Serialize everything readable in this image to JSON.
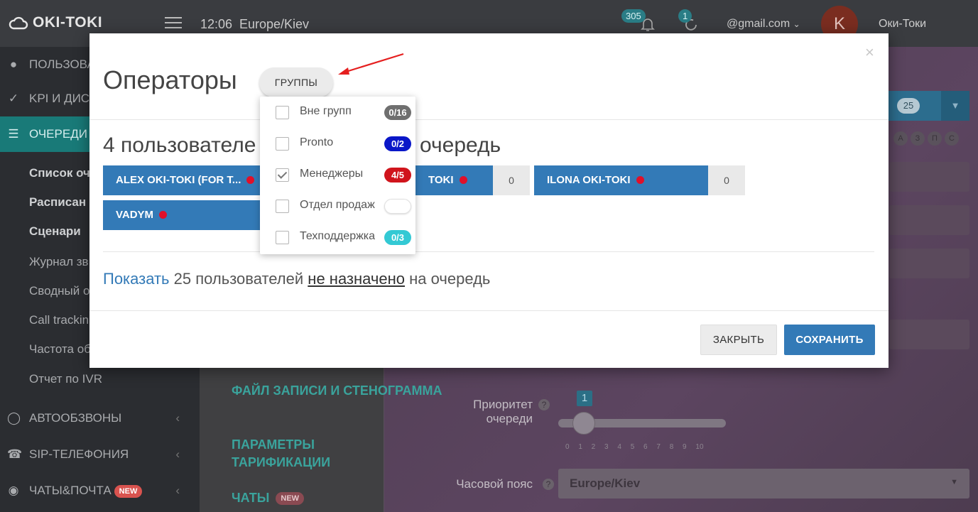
{
  "app": {
    "logo": "OKI-TOKI",
    "time": "12:06",
    "timezone": "Europe/Kiev",
    "notifications_count": "305",
    "tasks_count": "1",
    "email": "@gmail.com",
    "avatar_letter": "K",
    "user_name": "Оки-Токи"
  },
  "sidebar": {
    "items": [
      {
        "label": "ПОЛЬЗОВА",
        "icon": "user-icon"
      },
      {
        "label": "KPI И ДИС",
        "icon": "check-icon"
      },
      {
        "label": "ОЧЕРЕДИ",
        "icon": "list-icon"
      }
    ],
    "subitems": [
      "Список оч",
      "Расписан",
      "Сценари",
      "Журнал зв",
      "Сводный о",
      "Call trackin",
      "Частота об",
      "Отчет по IVR"
    ],
    "bottom_items": [
      {
        "label": "АВТООБЗВОНЫ",
        "icon": "clock-icon"
      },
      {
        "label": "SIP-ТЕЛЕФОНИЯ",
        "icon": "phone-icon"
      },
      {
        "label": "ЧАТЫ&ПОЧТА",
        "icon": "chat-icon",
        "badge": "NEW"
      }
    ]
  },
  "background": {
    "counter": "25",
    "alphabet": [
      "А",
      "З",
      "П",
      "С"
    ],
    "links": [
      "ФАЙЛ ЗАПИСИ И СТЕНОГРАММА",
      "ПАРАМЕТРЫ ТАРИФИКАЦИИ",
      "ЧАТЫ"
    ],
    "chats_badge": "NEW",
    "priority_label": "Приоритет очереди",
    "priority_value": "1",
    "ticks": "0 1 2 3 4 5 6 7 8 9 10",
    "tz_label": "Часовой пояс",
    "tz_value": "Europe/Kiev"
  },
  "modal": {
    "title": "Операторы",
    "groups_button": "ГРУППЫ",
    "close_symbol": "×",
    "heading_left": "4 пользователе",
    "heading_right": "очередь",
    "operators": [
      {
        "name": "ALEX OKI-TOKI (FOR T...",
        "count": ""
      },
      {
        "name": "TOKI",
        "count": "0"
      },
      {
        "name": "ILONA OKI-TOKI",
        "count": "0"
      },
      {
        "name": "VADYM",
        "count": ""
      }
    ],
    "show_link": "Показать",
    "show_text_1": "25 пользователей",
    "show_text_u": "не назначено",
    "show_text_2": "на очередь",
    "close_button": "ЗАКРЫТЬ",
    "save_button": "СОХРАНИТЬ"
  },
  "groups_dropdown": {
    "items": [
      {
        "label": "Вне групп",
        "badge": "0/16",
        "color": "#6f6f6f",
        "checked": false
      },
      {
        "label": "Pronto",
        "badge": "0/2",
        "color": "#0a17c8",
        "checked": false
      },
      {
        "label": "Менеджеры",
        "badge": "4/5",
        "color": "#d0141c",
        "checked": true
      },
      {
        "label": "Отдел продаж",
        "badge": "",
        "color": "#ffffff",
        "checked": false
      },
      {
        "label": "Техподдержка",
        "badge": "0/3",
        "color": "#33c9d4",
        "checked": false
      }
    ]
  },
  "colors": {
    "primary": "#337ab7",
    "teal": "#197a78",
    "arrow": "#e51f1f"
  }
}
